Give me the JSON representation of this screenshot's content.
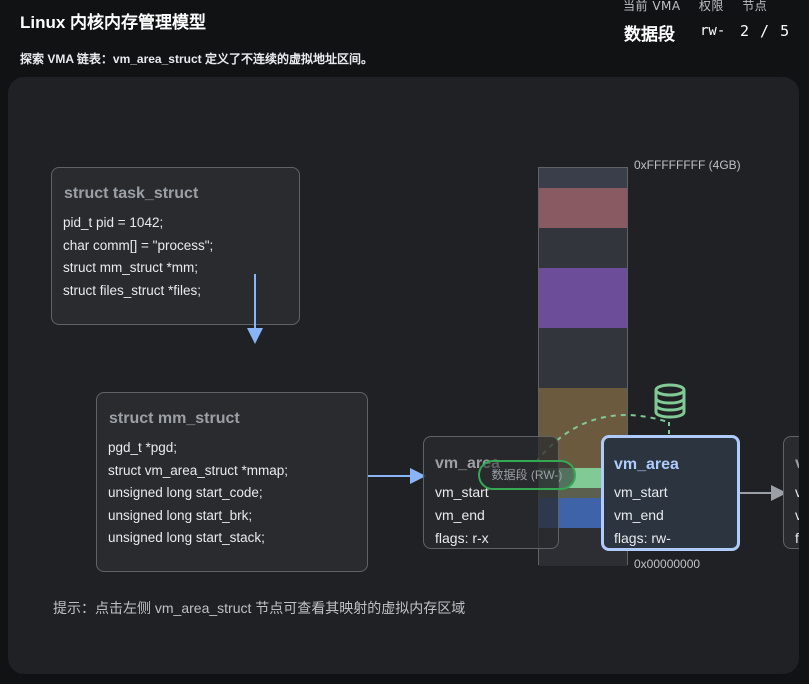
{
  "header": {
    "title": "Linux 内核内存管理模型",
    "subtitle": "探索 VMA 链表：vm_area_struct 定义了不连续的虚拟地址区间。"
  },
  "status": {
    "labels": [
      "当前 VMA",
      "权限",
      "节点"
    ],
    "current_region": "数据段",
    "permission": "rw-",
    "node_index": "2 / 5"
  },
  "task_struct": {
    "title": "struct task_struct",
    "fields": [
      "pid_t pid = 1042;",
      "char comm[] = \"process\";",
      "struct mm_struct *mm;",
      "struct files_struct *files;"
    ]
  },
  "mm_struct": {
    "title": "struct mm_struct",
    "fields": [
      "pgd_t *pgd;",
      "struct vm_area_struct *mmap;",
      "unsigned long start_code;",
      "unsigned long start_brk;",
      "unsigned long start_stack;"
    ]
  },
  "vma_nodes": [
    {
      "title": "vm_area",
      "start_label": "vm_start",
      "end_label": "vm_end",
      "flags": "flags: r-x"
    },
    {
      "title": "vm_area",
      "start_label": "vm_start",
      "end_label": "vm_end",
      "flags": "flags: rw-"
    },
    {
      "title": "v",
      "start_label": "v",
      "end_label": "v",
      "flags": "f"
    }
  ],
  "memory_map": {
    "top_address": "0xFFFFFFFF (4GB)",
    "bottom_address": "0x00000000",
    "segment_label": "数据段 (RW-)",
    "segments": [
      {
        "name": "top-band",
        "color": "#3a3d4a"
      },
      {
        "name": "stack",
        "color": "#8a5a63"
      },
      {
        "name": "gap-1",
        "color": "#33353d"
      },
      {
        "name": "mmap-region",
        "color": "#6b4d9a"
      },
      {
        "name": "gap-2",
        "color": "#33353d"
      },
      {
        "name": "heap",
        "color": "#6b5a3e"
      },
      {
        "name": "data",
        "color": "#81c995"
      },
      {
        "name": "bss",
        "color": "#5b5f4e"
      },
      {
        "name": "text",
        "color": "#3f63a8"
      },
      {
        "name": "bottom",
        "color": "#2d2e33"
      }
    ]
  },
  "colors": {
    "accent": "#aecbfa",
    "highlight": "#81c995",
    "link_arrow": "#8ab4f8"
  },
  "hint": "提示：点击左侧 vm_area_struct 节点可查看其映射的虚拟内存区域"
}
